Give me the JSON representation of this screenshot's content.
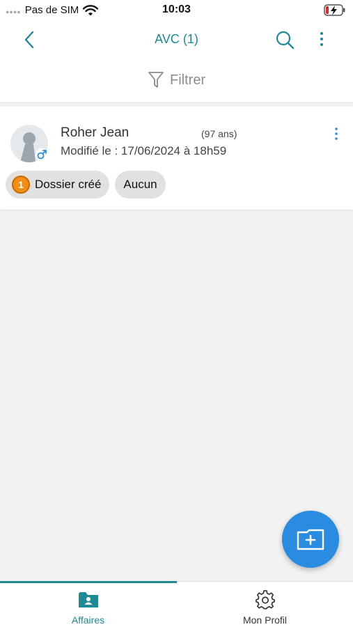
{
  "status_bar": {
    "carrier": "Pas de SIM",
    "time": "10:03",
    "icons": [
      "signal-dots-icon",
      "wifi-icon",
      "battery-charging-icon"
    ]
  },
  "nav": {
    "title": "AVC (1)",
    "icons": [
      "back-chevron-icon",
      "search-icon",
      "more-vertical-icon"
    ]
  },
  "filter": {
    "label": "Filtrer",
    "icon": "funnel-icon"
  },
  "patients": [
    {
      "name": "Roher Jean",
      "age": "(97 ans)",
      "modified": "Modifié le : 17/06/2024 à 18h59",
      "gender_icon": "male-symbol-icon",
      "chips": [
        {
          "badge": "1",
          "label": "Dossier créé"
        },
        {
          "label": "Aucun"
        }
      ]
    }
  ],
  "fab": {
    "icon": "folder-plus-icon"
  },
  "tabs": [
    {
      "label": "Affaires",
      "icon": "folder-user-icon",
      "active": true
    },
    {
      "label": "Mon Profil",
      "icon": "gear-icon",
      "active": false
    }
  ],
  "colors": {
    "accent": "#1e8a95",
    "fab": "#2a8ce0",
    "badge": "#f28e16",
    "background": "#f2f2f2"
  }
}
